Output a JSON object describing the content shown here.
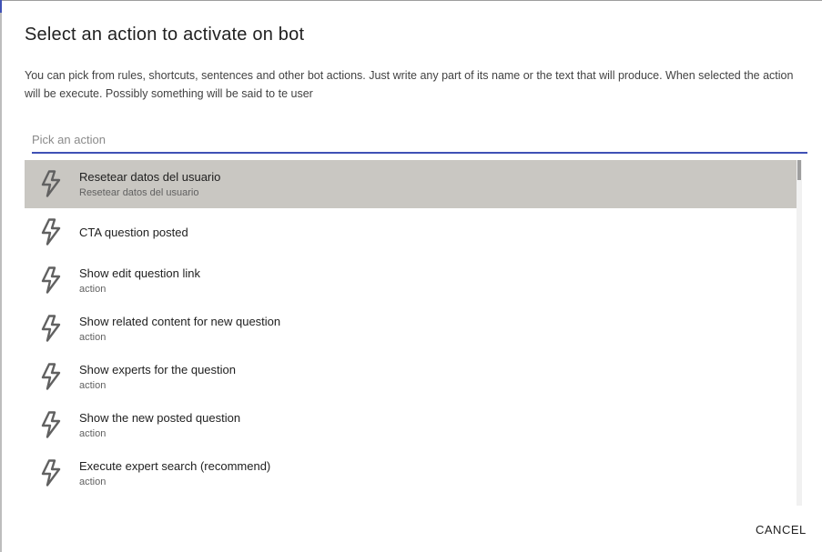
{
  "dialog": {
    "title": "Select an action to activate on bot",
    "description": "You can pick from rules, shortcuts, sentences and other bot actions. Just write any part of its name or the text that will produce. When selected the action will be execute. Possibly something will be said to te user",
    "search": {
      "placeholder": "Pick an action",
      "value": ""
    },
    "items": [
      {
        "primary": "Resetear datos del usuario",
        "secondary": "Resetear datos del usuario",
        "icon": "lightning-icon",
        "selected": true
      },
      {
        "primary": "CTA question posted",
        "secondary": "",
        "icon": "lightning-icon",
        "selected": false
      },
      {
        "primary": "Show edit question link",
        "secondary": "action",
        "icon": "lightning-icon",
        "selected": false
      },
      {
        "primary": "Show related content for new question",
        "secondary": "action",
        "icon": "lightning-icon",
        "selected": false
      },
      {
        "primary": "Show experts for the question",
        "secondary": "action",
        "icon": "lightning-icon",
        "selected": false
      },
      {
        "primary": "Show the new posted question",
        "secondary": "action",
        "icon": "lightning-icon",
        "selected": false
      },
      {
        "primary": "Execute expert search (recommend)",
        "secondary": "action",
        "icon": "lightning-icon",
        "selected": false
      }
    ],
    "cancel_label": "CANCEL"
  },
  "colors": {
    "accent": "#3f51b5",
    "selected_row": "#c9c7c2",
    "icon_stroke": "#616161"
  }
}
